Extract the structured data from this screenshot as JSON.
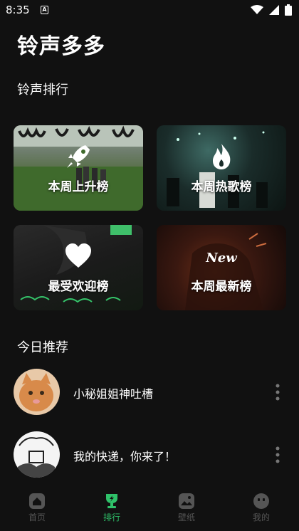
{
  "status": {
    "time": "8:35",
    "notif_glyph": "A"
  },
  "app": {
    "title": "铃声多多"
  },
  "ranking": {
    "title": "铃声排行",
    "cards": [
      {
        "label": "本周上升榜",
        "icon": "rocket-icon"
      },
      {
        "label": "本周热歌榜",
        "icon": "flame-icon"
      },
      {
        "label": "最受欢迎榜",
        "icon": "heart-icon"
      },
      {
        "label": "本周最新榜",
        "icon": "new-badge-icon",
        "badge_text": "New"
      }
    ]
  },
  "recommend": {
    "title": "今日推荐",
    "items": [
      {
        "title": "小秘姐姐神吐槽",
        "avatar": "cat-avatar"
      },
      {
        "title": "我的快递，你来了！",
        "avatar": "sketch-avatar"
      }
    ]
  },
  "nav": {
    "items": [
      {
        "label": "首页",
        "icon": "home-icon"
      },
      {
        "label": "排行",
        "icon": "trophy-icon",
        "active": true
      },
      {
        "label": "壁纸",
        "icon": "wallpaper-icon"
      },
      {
        "label": "我的",
        "icon": "smiley-icon"
      }
    ]
  },
  "colors": {
    "background": "#111111",
    "accent": "#2fc26a",
    "nav_inactive": "#555555"
  }
}
